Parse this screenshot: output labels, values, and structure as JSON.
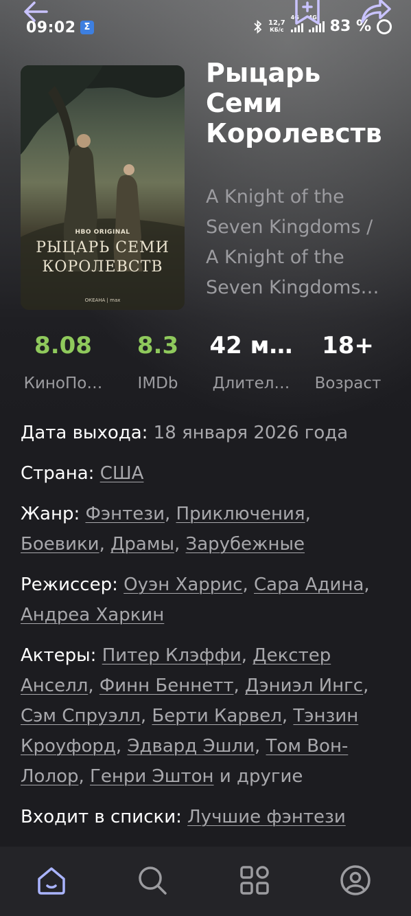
{
  "status_bar": {
    "time": "09:02",
    "app_badge": "Σ",
    "net_speed_value": "12,7",
    "net_speed_unit": "КБ/с",
    "network_1": "4G",
    "network_2": "4G",
    "battery": "83 %"
  },
  "poster": {
    "network_label": "HBO ORIGINAL",
    "title": "РЫЦАРЬ СЕМИ КОРОЛЕВСТВ",
    "footer": "ОКЕАНА | max"
  },
  "title": "Рыцарь Семи Королевств",
  "original_title": "A Knight of the Seven Kingdoms / A Knight of the Seven Kingdoms…",
  "ratings": [
    {
      "value": "8.08",
      "label": "КиноПо…"
    },
    {
      "value": "8.3",
      "label": "IMDb"
    },
    {
      "value": "42 м…",
      "label": "Длител…"
    },
    {
      "value": "18+",
      "label": "Возраст"
    }
  ],
  "details": {
    "release": {
      "label": "Дата выхода:",
      "value": "18 января 2026 года"
    },
    "country": {
      "label": "Страна:",
      "links": [
        "США"
      ]
    },
    "genre": {
      "label": "Жанр:",
      "links": [
        "Фэнтези",
        "Приключения",
        "Боевики",
        "Драмы",
        "Зарубежные"
      ]
    },
    "director": {
      "label": "Режиссер:",
      "links": [
        "Оуэн Харрис",
        "Сара Адина",
        "Андреа Харкин"
      ]
    },
    "actors": {
      "label": "Актеры:",
      "links": [
        "Питер Клэффи",
        "Декстер Анселл",
        "Финн Беннетт",
        "Дэниэл Ингс",
        "Сэм Спруэлл",
        "Берти Карвел",
        "Тэнзин Кроуфорд",
        "Эдвард Эшли",
        "Том Вон-Лолор",
        "Генри Эштон"
      ],
      "suffix": "и другие"
    },
    "lists": {
      "label": "Входит в списки:",
      "value": "Лучшие фэнтези"
    }
  },
  "icons": {
    "back": "back-arrow-icon",
    "save": "bookmark-add-icon",
    "share": "share-icon"
  },
  "bottom_nav": [
    {
      "name": "home",
      "icon": "home-icon",
      "active": true
    },
    {
      "name": "search",
      "icon": "search-icon",
      "active": false
    },
    {
      "name": "collections",
      "icon": "grid-icon",
      "active": false
    },
    {
      "name": "profile",
      "icon": "profile-icon",
      "active": false
    }
  ],
  "colors": {
    "background": "#1c1c20",
    "accent": "#8fc95c",
    "nav_active": "#aab4ff",
    "secondary_text": "#9c9ca0"
  }
}
